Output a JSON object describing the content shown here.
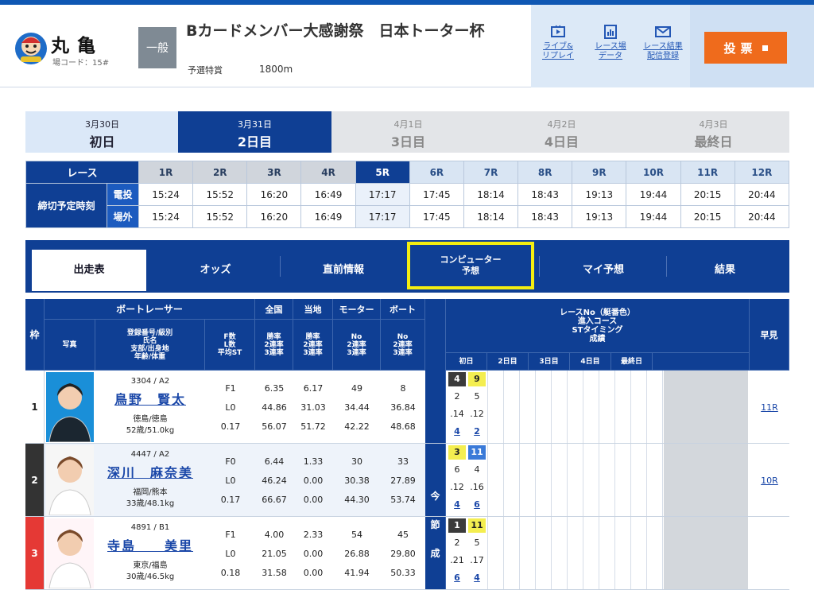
{
  "header": {
    "stadium_name": "丸亀",
    "stadium_code": "場コード：15#",
    "grade": "一般",
    "race_title": "Bカードメンバー大感謝祭　日本トーター杯",
    "race_type": "予選特賞",
    "race_distance": "1800m",
    "buttons": [
      {
        "label1": "ライブ&",
        "label2": "リプレイ",
        "icon": "tv-play-icon"
      },
      {
        "label1": "レース場",
        "label2": "データ",
        "icon": "data-chart-icon"
      },
      {
        "label1": "レース結果",
        "label2": "配信登録",
        "icon": "mail-icon"
      }
    ],
    "vote_label": "投票"
  },
  "days": [
    {
      "date": "3月30日",
      "name": "初日"
    },
    {
      "date": "3月31日",
      "name": "2日目"
    },
    {
      "date": "4月1日",
      "name": "3日目"
    },
    {
      "date": "4月2日",
      "name": "4日目"
    },
    {
      "date": "4月3日",
      "name": "最終日"
    }
  ],
  "race_table": {
    "race_label": "レース",
    "deadline_label": "締切予定時刻",
    "phone_label": "電投",
    "offsite_label": "場外",
    "races": [
      "1R",
      "2R",
      "3R",
      "4R",
      "5R",
      "6R",
      "7R",
      "8R",
      "9R",
      "10R",
      "11R",
      "12R"
    ],
    "phone_times": [
      "15:24",
      "15:52",
      "16:20",
      "16:49",
      "17:17",
      "17:45",
      "18:14",
      "18:43",
      "19:13",
      "19:44",
      "20:15",
      "20:44"
    ],
    "offsite_times": [
      "15:24",
      "15:52",
      "16:20",
      "16:49",
      "17:17",
      "17:45",
      "18:14",
      "18:43",
      "19:13",
      "19:44",
      "20:15",
      "20:44"
    ]
  },
  "nav": {
    "entry": "出走表",
    "odds": "オッズ",
    "before": "直前情報",
    "computer1": "コンピューター",
    "computer2": "予想",
    "my": "マイ予想",
    "result": "結果"
  },
  "entry_header": {
    "frame": "枠",
    "photo": "写真",
    "racer": "ボートレーサー",
    "reg1": "登録番号/級別",
    "reg2": "氏名",
    "reg3": "支部/出身地",
    "reg4": "年齢/体重",
    "f1": "F数",
    "f2": "L数",
    "f3": "平均ST",
    "nat": "全国",
    "nat1": "勝率",
    "nat2": "2連率",
    "nat3": "3連率",
    "loc": "当地",
    "loc1": "勝率",
    "loc2": "2連率",
    "loc3": "3連率",
    "mot": "モーター",
    "mot1": "No",
    "mot2": "2連率",
    "mot3": "3連率",
    "boat": "ボート",
    "boat1": "No",
    "boat2": "2連率",
    "boat3": "3連率",
    "this_series1": "今",
    "this_series2": "節",
    "this_series3": "成",
    "info1": "レースNo（艇番色）",
    "info2": "進入コース",
    "info3": "STタイミング",
    "info4": "成績",
    "day1": "初日",
    "day2": "2日目",
    "day3": "3日目",
    "day4": "4日目",
    "day5": "最終日",
    "early": "早見"
  },
  "racers": [
    {
      "frame": "1",
      "reg": "3304 / A2",
      "name": "鳥野　賢太",
      "branch": "徳島/徳島",
      "age": "52歳/51.0kg",
      "f": "F1",
      "l": "L0",
      "st": "0.17",
      "nat": [
        "6.35",
        "44.86",
        "56.07"
      ],
      "loc": [
        "6.17",
        "31.03",
        "51.72"
      ],
      "mot": [
        "49",
        "34.44",
        "42.22"
      ],
      "boat": [
        "8",
        "36.84",
        "48.68"
      ],
      "s1": [
        {
          "v": "4",
          "c": "#3b3b3b",
          "t": "#fff"
        },
        {
          "v": "9",
          "c": "#f4ee50",
          "t": "#222"
        }
      ],
      "s2": [
        "2",
        "5"
      ],
      "s3": [
        ".14",
        ".12"
      ],
      "s4": [
        "4",
        "2"
      ],
      "early": "11R"
    },
    {
      "frame": "2",
      "reg": "4447 / A2",
      "name": "深川　麻奈美",
      "branch": "福岡/熊本",
      "age": "33歳/48.1kg",
      "f": "F0",
      "l": "L0",
      "st": "0.17",
      "nat": [
        "6.44",
        "46.24",
        "66.67"
      ],
      "loc": [
        "1.33",
        "0.00",
        "0.00"
      ],
      "mot": [
        "30",
        "30.38",
        "44.30"
      ],
      "boat": [
        "33",
        "27.89",
        "53.74"
      ],
      "s1": [
        {
          "v": "3",
          "c": "#f4ee50",
          "t": "#222"
        },
        {
          "v": "11",
          "c": "#3a7ad8",
          "t": "#fff"
        }
      ],
      "s2": [
        "6",
        "4"
      ],
      "s3": [
        ".12",
        ".16"
      ],
      "s4": [
        "4",
        "6"
      ],
      "early": "10R"
    },
    {
      "frame": "3",
      "reg": "4891 / B1",
      "name": "寺島　　美里",
      "branch": "東京/福島",
      "age": "30歳/46.5kg",
      "f": "F1",
      "l": "L0",
      "st": "0.18",
      "nat": [
        "4.00",
        "21.05",
        "31.58"
      ],
      "loc": [
        "2.33",
        "0.00",
        "0.00"
      ],
      "mot": [
        "54",
        "26.88",
        "41.94"
      ],
      "boat": [
        "45",
        "29.80",
        "50.33"
      ],
      "s1": [
        {
          "v": "1",
          "c": "#3b3b3b",
          "t": "#fff"
        },
        {
          "v": "11",
          "c": "#f4ee50",
          "t": "#222"
        }
      ],
      "s2": [
        "2",
        "5"
      ],
      "s3": [
        ".21",
        ".17"
      ],
      "s4": [
        "6",
        "4"
      ],
      "early": ""
    }
  ],
  "colors": {
    "frame1": "#ffffff",
    "frame2": "#333333",
    "frame3": "#e53935",
    "accent": "#0f3f94",
    "vote": "#ef6b1c"
  }
}
